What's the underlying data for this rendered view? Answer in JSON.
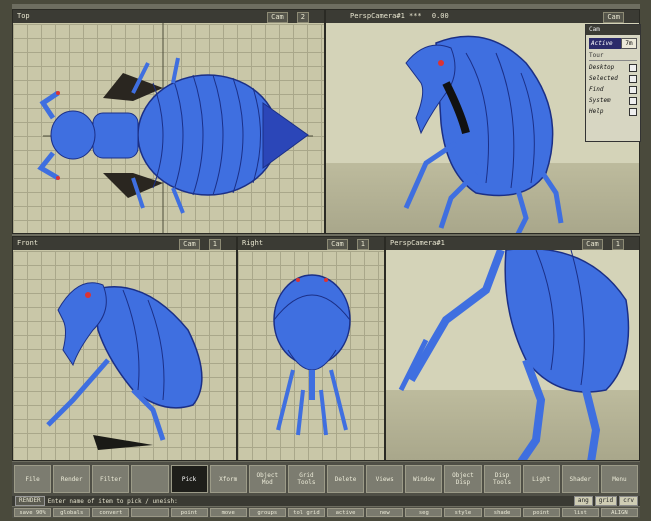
{
  "viewports": {
    "top": {
      "name": "Top",
      "chip1": "Cam",
      "chip2": "2"
    },
    "persp_main": {
      "name": "PerspCamera#1 ***",
      "value": "0.00",
      "chip": "Cam"
    },
    "front": {
      "name": "Front",
      "chip1": "Cam",
      "chip2": "1"
    },
    "right": {
      "name": "Right",
      "chip1": "Cam",
      "chip2": "1"
    },
    "persp_small": {
      "name": "PerspCamera#1",
      "chip1": "Cam",
      "chip2": "1"
    }
  },
  "popup": {
    "header": "Cam",
    "active_label": "Active",
    "active_value": "7m",
    "section": "Tour",
    "items": [
      "Desktop",
      "Selected",
      "Find",
      "System",
      "Help"
    ]
  },
  "toolbar": [
    "File",
    "Render",
    "Filter",
    "",
    "Pick",
    "Xform",
    "Object Mod",
    "Grid Tools",
    "Delete",
    "Views",
    "Window",
    "Object Disp",
    "Disp Tools",
    "Light",
    "Shader",
    "Menu"
  ],
  "toolbar_selected": "Pick",
  "command": {
    "mode": "RENDER",
    "prompt": "Enter name of item to pick / uneish:",
    "buttons": [
      "ang",
      "grid",
      "crv"
    ]
  },
  "subbar": [
    "save 90%",
    "globals",
    "convert",
    "",
    "point",
    "move",
    "groups",
    "tol grid",
    "active",
    "new",
    "seg",
    "style",
    "shade",
    "point",
    "list",
    "ALIGN"
  ],
  "colors": {
    "viewport_bg": "#c9c7a8",
    "model_blue": "#3f6fe0",
    "model_dark": "#1b2f86",
    "selected_button": "#1e1e1a"
  }
}
